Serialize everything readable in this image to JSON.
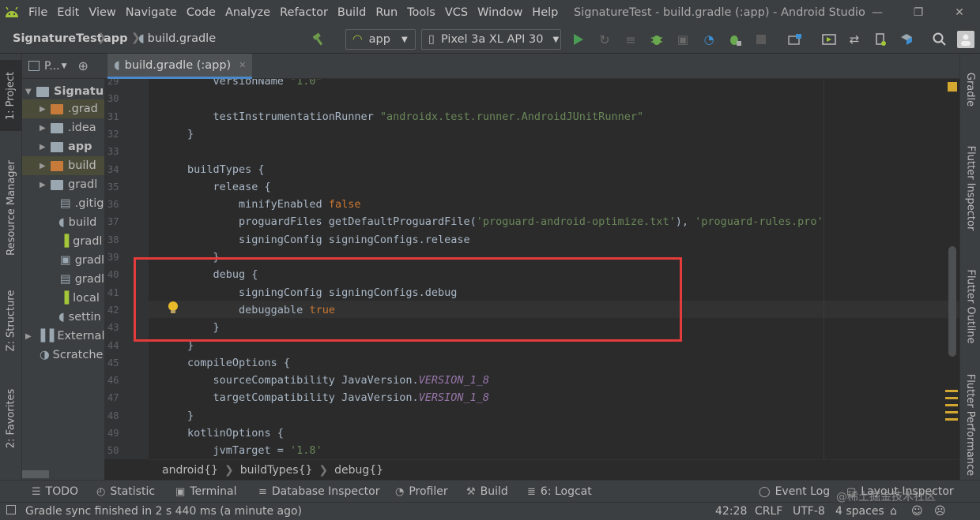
{
  "menubar": {
    "items": [
      "File",
      "Edit",
      "View",
      "Navigate",
      "Code",
      "Analyze",
      "Refactor",
      "Build",
      "Run",
      "Tools",
      "VCS",
      "Window",
      "Help"
    ],
    "window_title": "SignatureTest - build.gradle (:app) - Android Studio"
  },
  "navbar": {
    "crumbs": [
      "SignatureTest",
      "app",
      "build.gradle"
    ],
    "run_config": "app",
    "device": "Pixel 3a XL API 30"
  },
  "left_tools": {
    "project": "1: Project",
    "resource_manager": "Resource Manager",
    "structure": "Z: Structure",
    "favorites": "2: Favorites"
  },
  "right_tools": {
    "gradle": "Gradle",
    "flutter_inspector": "Flutter Inspector",
    "flutter_outline": "Flutter Outline",
    "flutter_performance": "Flutter Performance"
  },
  "project_panel": {
    "header_label": "P...",
    "items": [
      {
        "label": "Signatur"
      },
      {
        "label": ".grad"
      },
      {
        "label": ".idea"
      },
      {
        "label": "app"
      },
      {
        "label": "build"
      },
      {
        "label": "gradl"
      },
      {
        "label": ".gitig"
      },
      {
        "label": "build"
      },
      {
        "label": "gradl"
      },
      {
        "label": "gradl"
      },
      {
        "label": "gradl"
      },
      {
        "label": "local"
      },
      {
        "label": "settin"
      },
      {
        "label": "External"
      },
      {
        "label": "Scratche"
      }
    ]
  },
  "editor": {
    "tab_label": "build.gradle (:app)",
    "lines": [
      {
        "n": "29",
        "text": "        versionName \"1.0\""
      },
      {
        "n": "30",
        "text": ""
      },
      {
        "n": "31",
        "text": "        testInstrumentationRunner \"androidx.test.runner.AndroidJUnitRunner\""
      },
      {
        "n": "32",
        "text": "    }"
      },
      {
        "n": "33",
        "text": ""
      },
      {
        "n": "34",
        "text": "    buildTypes {"
      },
      {
        "n": "35",
        "text": "        release {"
      },
      {
        "n": "36",
        "text": "            minifyEnabled false"
      },
      {
        "n": "37",
        "text": "            proguardFiles getDefaultProguardFile('proguard-android-optimize.txt'), 'proguard-rules.pro'"
      },
      {
        "n": "38",
        "text": "            signingConfig signingConfigs.release"
      },
      {
        "n": "39",
        "text": "        }"
      },
      {
        "n": "40",
        "text": "        debug {"
      },
      {
        "n": "41",
        "text": "            signingConfig signingConfigs.debug"
      },
      {
        "n": "42",
        "text": "            debuggable true"
      },
      {
        "n": "43",
        "text": "        }"
      },
      {
        "n": "44",
        "text": "    }"
      },
      {
        "n": "45",
        "text": "    compileOptions {"
      },
      {
        "n": "46",
        "text": "        sourceCompatibility JavaVersion.VERSION_1_8"
      },
      {
        "n": "47",
        "text": "        targetCompatibility JavaVersion.VERSION_1_8"
      },
      {
        "n": "48",
        "text": "    }"
      },
      {
        "n": "49",
        "text": "    kotlinOptions {"
      },
      {
        "n": "50",
        "text": "        jvmTarget = '1.8'"
      }
    ],
    "breadcrumbs": [
      "android{}",
      "buildTypes{}",
      "debug{}"
    ]
  },
  "bottom_tools": {
    "todo": "TODO",
    "statistic": "Statistic",
    "terminal": "Terminal",
    "database_inspector": "Database Inspector",
    "profiler": "Profiler",
    "build": "Build",
    "logcat": "6: Logcat",
    "event_log": "Event Log",
    "layout_inspector": "Layout Inspector"
  },
  "status": {
    "message": "Gradle sync finished in 2 s 440 ms (a minute ago)",
    "position": "42:28",
    "line_sep": "CRLF",
    "encoding": "UTF-8",
    "indent": "4 spaces",
    "watermark": "@稀土掘金技术社区"
  },
  "colors": {
    "highlight_box": "#e43b3b",
    "keyword": "#cc7832",
    "string": "#6a8759",
    "field": "#9876aa",
    "android_green": "#a4c639"
  }
}
